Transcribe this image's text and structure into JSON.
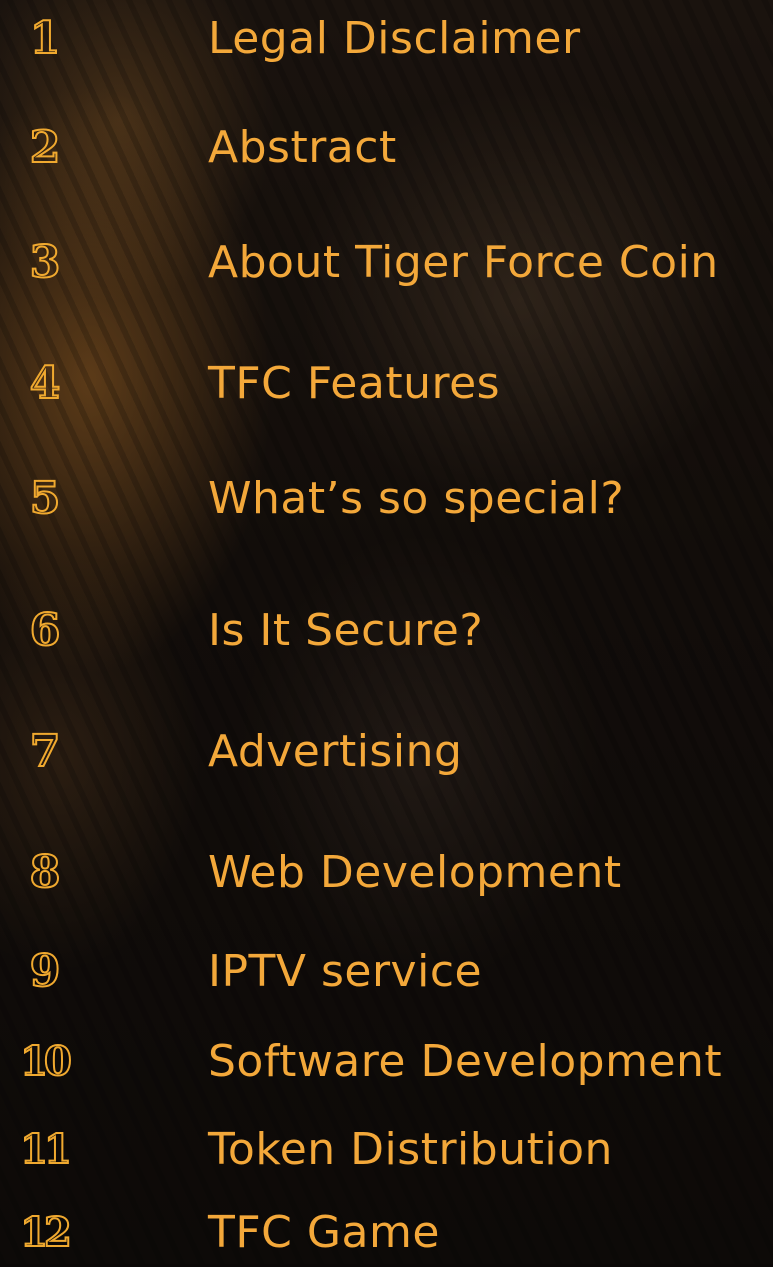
{
  "toc": {
    "items": [
      {
        "number": "1",
        "title": "Legal Disclaimer"
      },
      {
        "number": "2",
        "title": "Abstract"
      },
      {
        "number": "3",
        "title": "About Tiger Force Coin"
      },
      {
        "number": "4",
        "title": "TFC Features"
      },
      {
        "number": "5",
        "title": "What’s so special?"
      },
      {
        "number": "6",
        "title": "Is It Secure?"
      },
      {
        "number": "7",
        "title": "Advertising"
      },
      {
        "number": "8",
        "title": "Web Development"
      },
      {
        "number": "9",
        "title": "IPTV service"
      },
      {
        "number": "10",
        "title": "Software Development"
      },
      {
        "number": "11",
        "title": "Token Distribution"
      },
      {
        "number": "12",
        "title": "TFC Game"
      }
    ]
  },
  "colors": {
    "accent": "#f3a83a",
    "background": "#0b0807"
  }
}
